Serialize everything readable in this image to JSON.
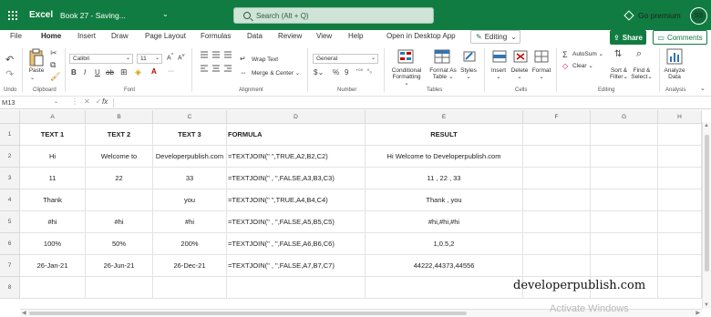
{
  "titlebar": {
    "app": "Excel",
    "document": "Book 27 - Saving...",
    "search_placeholder": "Search (Alt + Q)",
    "premium": "Go premium",
    "avatar": "SS"
  },
  "tabs": [
    "File",
    "Home",
    "Insert",
    "Draw",
    "Page Layout",
    "Formulas",
    "Data",
    "Review",
    "View",
    "Help",
    "Open in Desktop App"
  ],
  "active_tab": "Home",
  "editing_mode": "Editing",
  "share_label": "Share",
  "comments_label": "Comments",
  "ribbon": {
    "undo_label": "Undo",
    "clipboard": {
      "paste": "Paste",
      "group": "Clipboard"
    },
    "font": {
      "name": "Calibri",
      "size": "11",
      "group": "Font"
    },
    "alignment": {
      "wrap": "Wrap Text",
      "merge": "Merge & Center",
      "group": "Alignment"
    },
    "number": {
      "format": "General",
      "group": "Number"
    },
    "tables": {
      "conditional": [
        "Conditional",
        "Formatting"
      ],
      "format_as": [
        "Format As",
        "Table"
      ],
      "styles": "Styles",
      "group": "Tables"
    },
    "cells": {
      "insert": "Insert",
      "delete": "Delete",
      "format": "Format",
      "group": "Cells"
    },
    "editing": {
      "autosum": "AutoSum",
      "clear": "Clear",
      "sort": [
        "Sort &",
        "Filter"
      ],
      "find": [
        "Find &",
        "Select"
      ],
      "group": "Editing"
    },
    "analysis": {
      "analyze": [
        "Analyze",
        "Data"
      ],
      "group": "Analysis"
    }
  },
  "formula_bar": {
    "namebox": "M13",
    "fx": "fx",
    "content": ""
  },
  "columns": [
    "A",
    "B",
    "C",
    "D",
    "E",
    "F",
    "G",
    "H"
  ],
  "rows": [
    "1",
    "2",
    "3",
    "4",
    "5",
    "6",
    "7",
    "8"
  ],
  "cells": [
    [
      "TEXT 1",
      "TEXT 2",
      "TEXT 3",
      "FORMULA",
      "RESULT",
      "",
      "",
      ""
    ],
    [
      "Hi",
      "Welcome to",
      "Developerpublish.com",
      "=TEXTJOIN(\" \",TRUE,A2,B2,C2)",
      "Hi Welcome to Developerpublish.com",
      "",
      "",
      ""
    ],
    [
      "11",
      "22",
      "33",
      "=TEXTJOIN(\" , \",FALSE,A3,B3,C3)",
      "11 , 22 , 33",
      "",
      "",
      ""
    ],
    [
      "Thank",
      "",
      "you",
      "=TEXTJOIN(\" \",TRUE,A4,B4,C4)",
      "Thank , you",
      "",
      "",
      ""
    ],
    [
      "#hi",
      "#hi",
      "#hi",
      "=TEXTJOIN(\" , \",FALSE,A5,B5,C5)",
      "#hi,#hi,#hi",
      "",
      "",
      ""
    ],
    [
      "100%",
      "50%",
      "200%",
      "=TEXTJOIN(\" , \",FALSE,A6,B6,C6)",
      "1,0.5,2",
      "",
      "",
      ""
    ],
    [
      "26-Jan-21",
      "26-Jun-21",
      "26-Dec-21",
      "=TEXTJOIN(\" , \",FALSE,A7,B7,C7)",
      "44222,44373,44556",
      "",
      "",
      ""
    ],
    [
      "",
      "",
      "",
      "",
      "",
      "",
      "",
      ""
    ]
  ],
  "brand_watermark": "developerpublish.com",
  "activate_text": "Activate Windows"
}
